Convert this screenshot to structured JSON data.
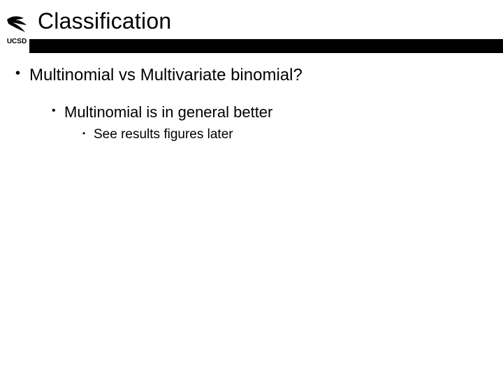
{
  "logo_label": "UCSD",
  "title": "Classification",
  "bullets": {
    "l1": "Multinomial vs Multivariate binomial?",
    "l2": "Multinomial is in general better",
    "l3": "See results figures later"
  }
}
